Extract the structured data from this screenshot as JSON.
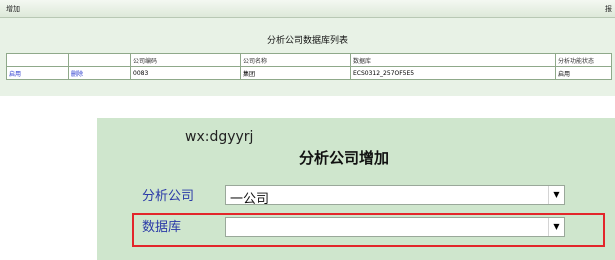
{
  "topbar": {
    "title": "增加",
    "right_label": "报"
  },
  "list": {
    "title": "分析公司数据库列表",
    "columns": [
      "",
      "",
      "公司编码",
      "公司名称",
      "数据库",
      "分析功能状态"
    ],
    "rows": [
      {
        "action1": "启用",
        "action2": "删除",
        "code": "0083",
        "name": "集团",
        "database": "ECS0312_257OF5E5",
        "status": "启用"
      }
    ]
  },
  "form": {
    "watermark": "wx:dgyyrj",
    "title": "分析公司增加",
    "company_label": "分析公司",
    "company_value": "一公司",
    "database_label": "数据库",
    "database_value": "",
    "dropdown_arrow": "▼"
  },
  "colors": {
    "highlight": "#e3262b",
    "panel": "#cfe6cd",
    "link": "#2233cc"
  }
}
